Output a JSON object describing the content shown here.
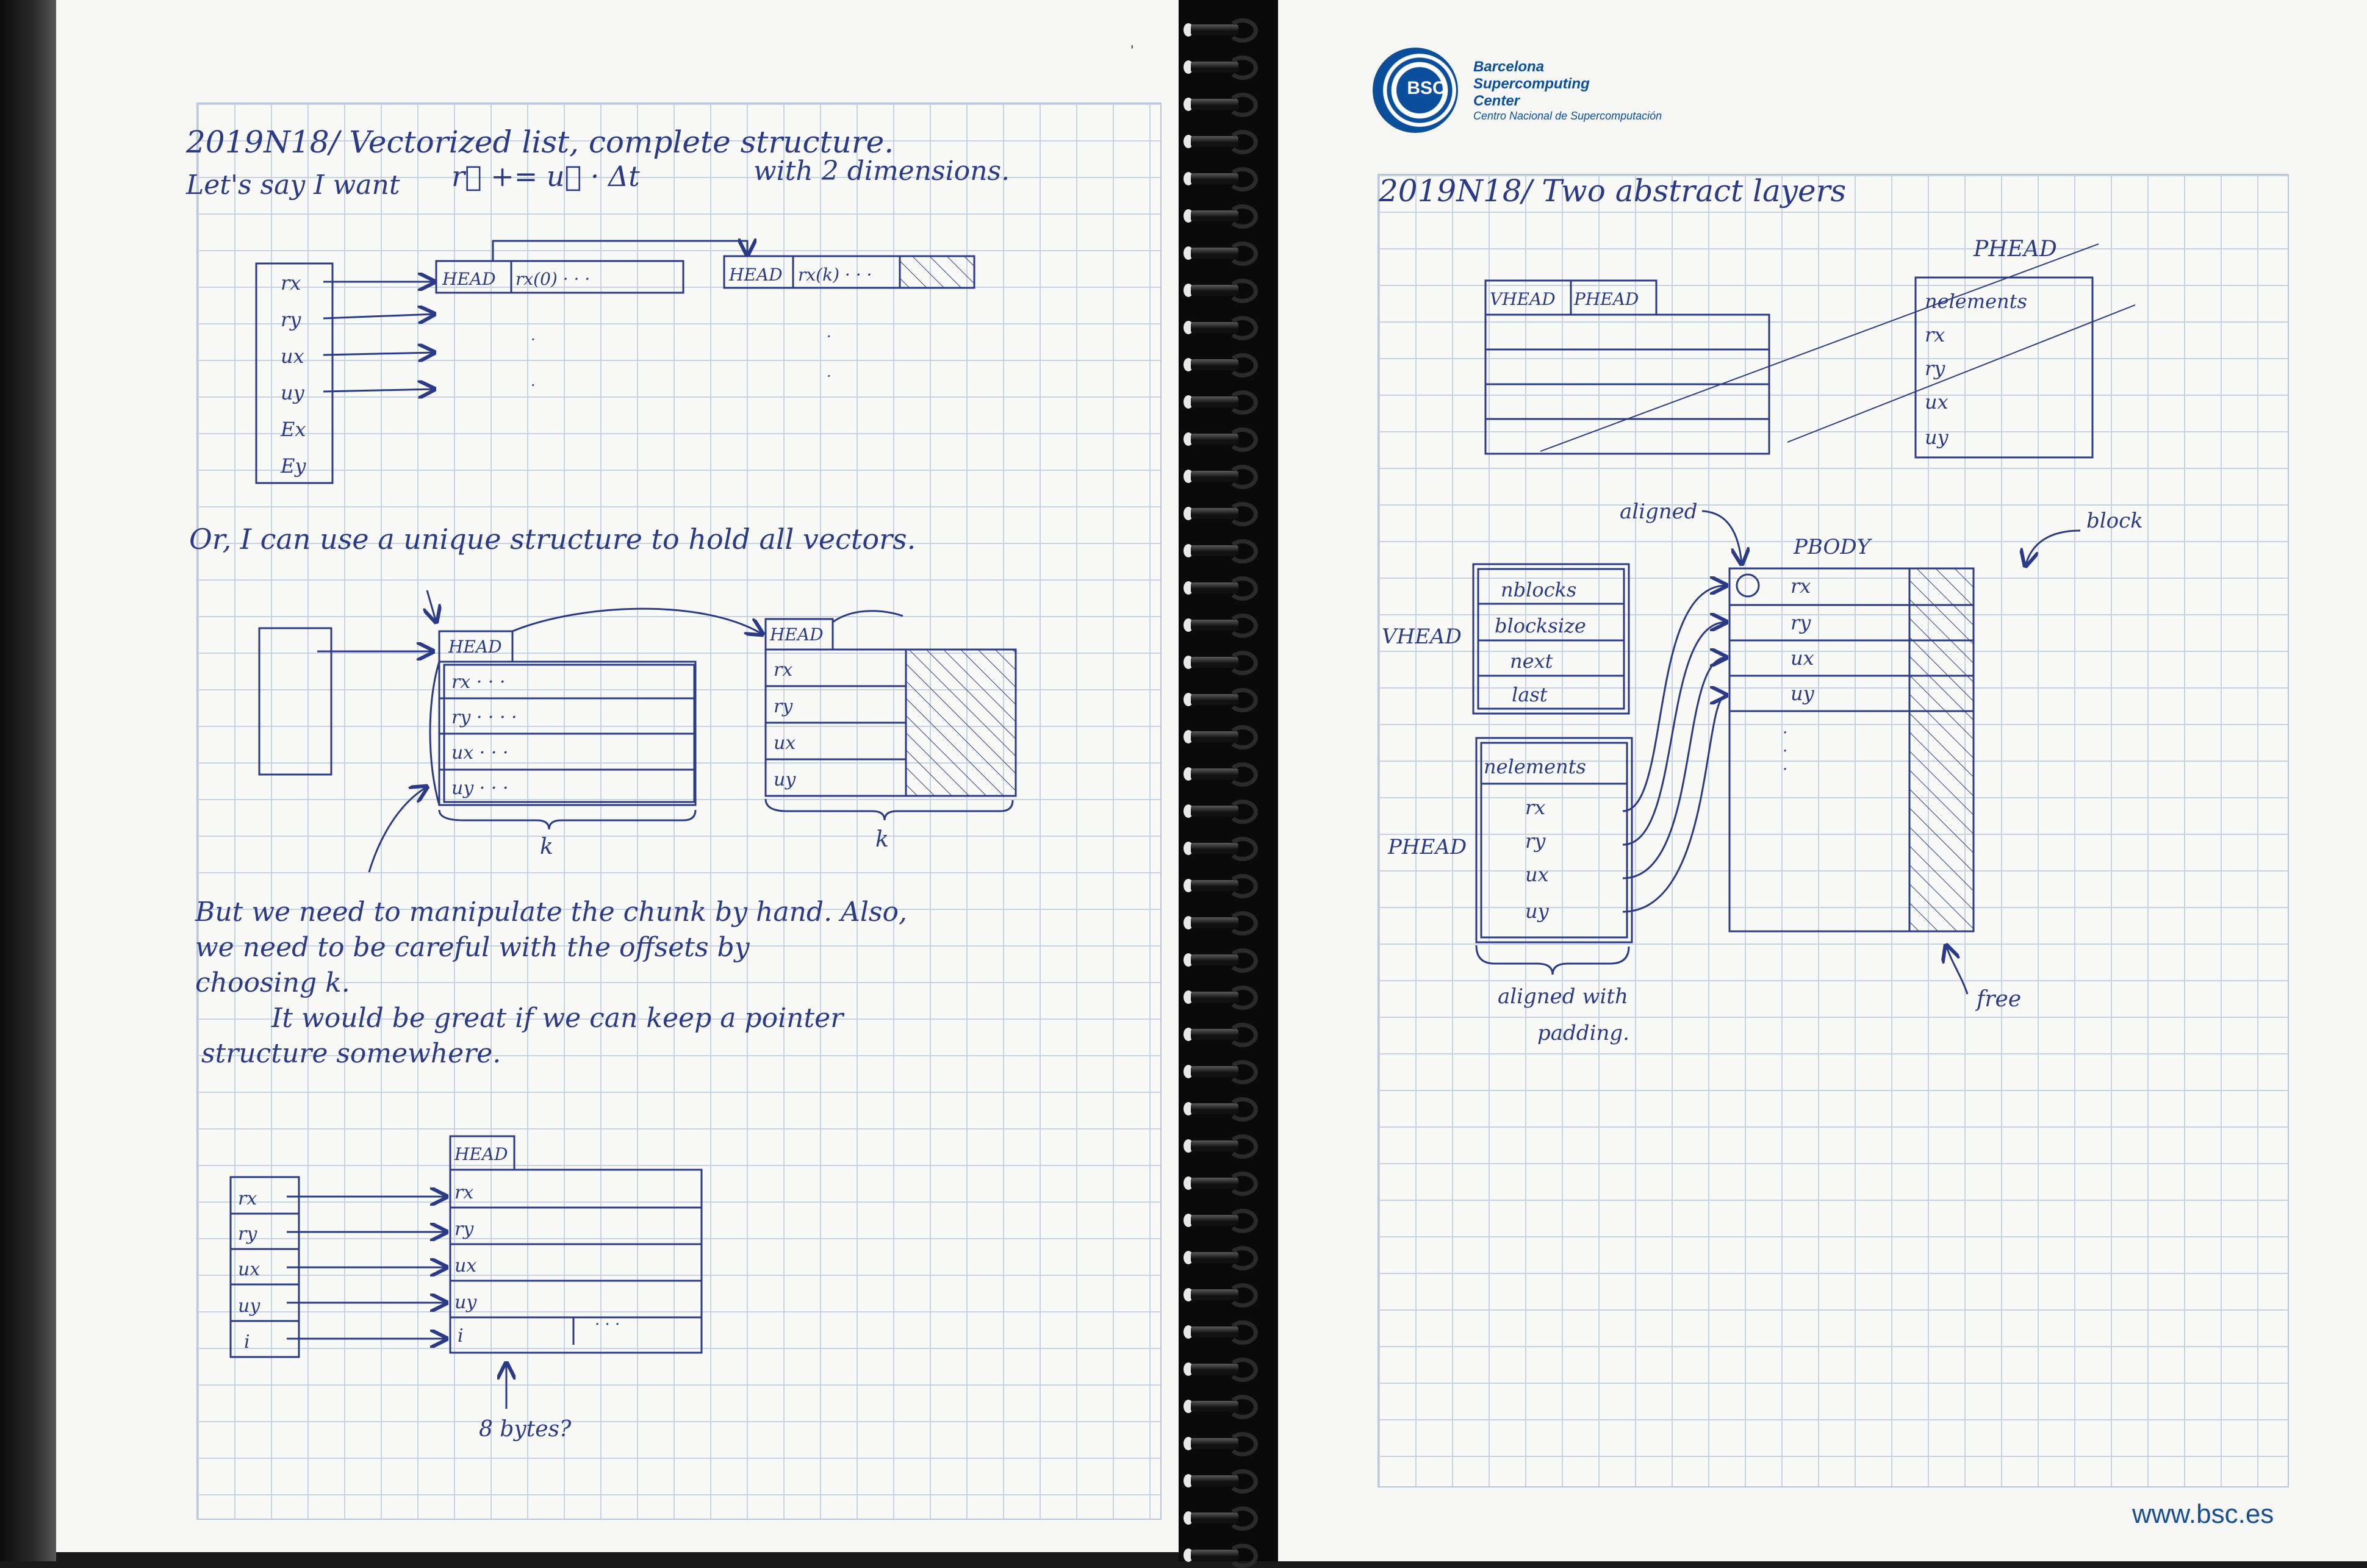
{
  "left_page": {
    "title": "2019N18/ Vectorized list, complete structure.",
    "line2_a": "Let's say I want",
    "line2_formula": "r⃗ += u⃗ · Δt",
    "line2_b": "with   2  dimensions.",
    "diag1": {
      "rows": [
        "rx",
        "ry",
        "ux",
        "uy",
        "Ex",
        "Ey"
      ],
      "chunk1_head": "HEAD",
      "chunk1_cell": "rx(0) · · ·",
      "chunk2_head": "HEAD",
      "chunk2_cell": "rx(k) · · ·"
    },
    "text2": "Or, I can use a unique structure to hold all vectors.",
    "diag2": {
      "head1": "HEAD",
      "rows1": [
        "rx · · ·",
        "ry · · · ·",
        "ux · · ·",
        "uy · · ·"
      ],
      "head2": "HEAD",
      "rows2": [
        "rx",
        "ry",
        "ux",
        "uy"
      ],
      "k1": "k",
      "k2": "k"
    },
    "text3_l1": "But we need to manipulate the chunk by hand. Also,",
    "text3_l2": "we need to be careful with the offsets by",
    "text3_l3": "choosing k.",
    "text3_l4": "It would be great if we can keep a pointer",
    "text3_l5": "structure somewhere.",
    "diag3": {
      "rows_left": [
        "rx",
        "ry",
        "ux",
        "uy",
        "i"
      ],
      "head": "HEAD",
      "rows_right": [
        "rx",
        "ry",
        "ux",
        "uy",
        "i"
      ],
      "dots": "· · ·",
      "note": "8 bytes?"
    }
  },
  "right_page": {
    "logo": {
      "mark": "BSC",
      "name_l1": "Barcelona",
      "name_l2": "Supercomputing",
      "name_l3": "Center",
      "subtitle": "Centro Nacional de Supercomputación"
    },
    "title": "2019N18/ Two abstract layers",
    "diag1": {
      "vhead": "VHEAD",
      "phead": "PHEAD",
      "phead_label": "PHEAD",
      "phead_rows": [
        "nelements",
        "rx",
        "ry",
        "ux",
        "uy"
      ]
    },
    "diag2": {
      "aligned": "aligned",
      "pbody": "PBODY",
      "block": "block",
      "vhead_label": "VHEAD",
      "vhead_rows": [
        "nblocks",
        "blocksize",
        "next",
        "last"
      ],
      "phead_label": "PHEAD",
      "phead_rows": [
        "nelements",
        "rx",
        "ry",
        "ux",
        "uy"
      ],
      "pbody_rows": [
        "rx",
        "ry",
        "ux",
        "uy"
      ],
      "free": "free",
      "aligned_padding_l1": "aligned with",
      "aligned_padding_l2": "padding."
    },
    "website": "www.bsc.es"
  },
  "corner_mark": "'"
}
